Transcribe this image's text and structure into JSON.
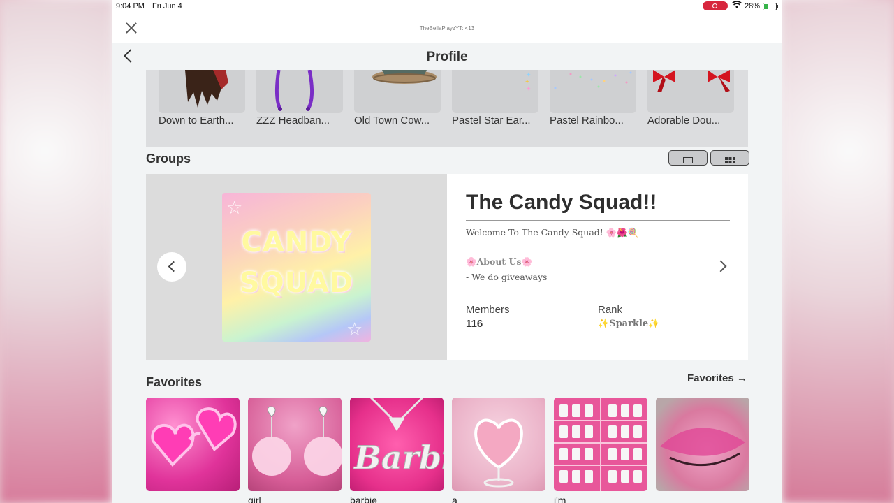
{
  "status_bar": {
    "time": "9:04 PM",
    "date": "Fri Jun 4",
    "battery": "28%"
  },
  "window": {
    "user_tag": "TheBellaPlayzYT: <13"
  },
  "header": {
    "title": "Profile"
  },
  "currently_wearing": [
    {
      "label": "Down to Earth..."
    },
    {
      "label": "ZZZ Headban..."
    },
    {
      "label": "Old Town Cow..."
    },
    {
      "label": "Pastel Star Ear..."
    },
    {
      "label": "Pastel Rainbo..."
    },
    {
      "label": "Adorable Dou..."
    }
  ],
  "groups": {
    "title": "Groups",
    "card": {
      "logo_line1": "CANDY",
      "logo_line2": "SQUAD",
      "name": "The Candy Squad!!",
      "welcome": "Welcome To The Candy Squad! 🌸🌺🍭",
      "about_heading": "🌸About Us🌸",
      "about_text": "- We do giveaways",
      "members_label": "Members",
      "members_value": "116",
      "rank_label": "Rank",
      "rank_value": "✨Sparkle✨"
    }
  },
  "favorites": {
    "title": "Favorites",
    "link": "Favorites →",
    "items": [
      {
        "label": ""
      },
      {
        "label": "girl"
      },
      {
        "label": "barbie"
      },
      {
        "label": "a"
      },
      {
        "label": "i'm"
      },
      {
        "label": ""
      }
    ]
  },
  "colors": {
    "accent_pink": "#e83e8c",
    "record_red": "#d7263d",
    "battery_green": "#36b34a"
  }
}
